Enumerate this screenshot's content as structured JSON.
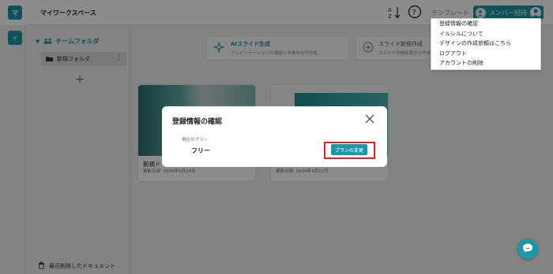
{
  "header": {
    "workspace_initial": "マ",
    "workspace_title": "マイワークスペース",
    "template_label": "テンプレート",
    "invite_label": "メンバー招待"
  },
  "left_rail": {
    "folder_initial": "イ"
  },
  "sidebar": {
    "team_folder_label": "チームフォルダ",
    "folders": [
      {
        "label": "新規フォルダ"
      }
    ],
    "trash_label": "最近削除したドキュメント"
  },
  "main": {
    "ai_card": {
      "title": "AIスライド生成",
      "subtitle": "プレゼンテーションの構成と中身をAIで作成"
    },
    "new_slide_card": {
      "title": "スライド新規作成",
      "subtitle": "スライド作成画面から作成"
    },
    "slides": [
      {
        "name": "新規ド",
        "date": "更新日時: 2024年5月14日"
      },
      {
        "name": "",
        "date": "更新日時: 2024年4月12日"
      }
    ]
  },
  "account_menu": {
    "items": [
      {
        "label": "登録情報の確認"
      },
      {
        "label": "イルシルについて"
      },
      {
        "label": "デザインの作成依頼はこちら"
      },
      {
        "label": "ログアウト"
      },
      {
        "label": "アカウントの削除"
      }
    ]
  },
  "modal": {
    "title": "登録情報の確認",
    "plan_label": "現在のプラン",
    "plan_value": "フリー",
    "change_plan_button": "プランの変更"
  },
  "colors": {
    "accent": "#1b97a8",
    "highlight": "#e02020"
  }
}
